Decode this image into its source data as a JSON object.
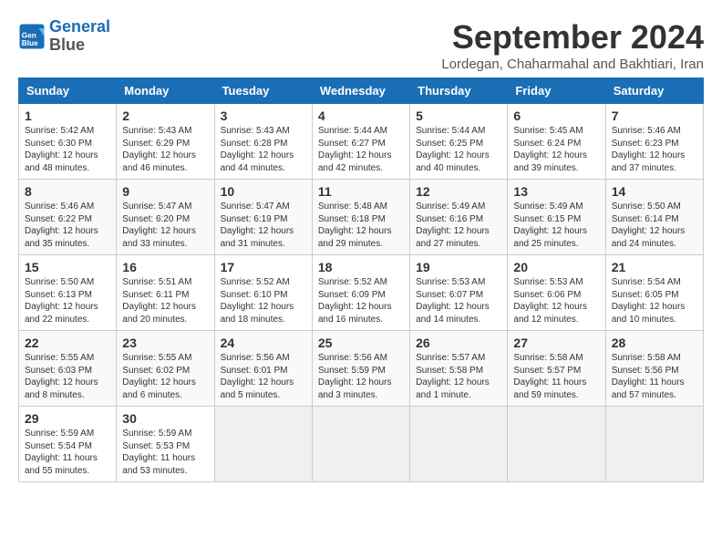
{
  "logo": {
    "line1": "General",
    "line2": "Blue"
  },
  "title": "September 2024",
  "subtitle": "Lordegan, Chaharmahal and Bakhtiari, Iran",
  "headers": [
    "Sunday",
    "Monday",
    "Tuesday",
    "Wednesday",
    "Thursday",
    "Friday",
    "Saturday"
  ],
  "weeks": [
    [
      {
        "day": "1",
        "sunrise": "Sunrise: 5:42 AM",
        "sunset": "Sunset: 6:30 PM",
        "daylight": "Daylight: 12 hours and 48 minutes."
      },
      {
        "day": "2",
        "sunrise": "Sunrise: 5:43 AM",
        "sunset": "Sunset: 6:29 PM",
        "daylight": "Daylight: 12 hours and 46 minutes."
      },
      {
        "day": "3",
        "sunrise": "Sunrise: 5:43 AM",
        "sunset": "Sunset: 6:28 PM",
        "daylight": "Daylight: 12 hours and 44 minutes."
      },
      {
        "day": "4",
        "sunrise": "Sunrise: 5:44 AM",
        "sunset": "Sunset: 6:27 PM",
        "daylight": "Daylight: 12 hours and 42 minutes."
      },
      {
        "day": "5",
        "sunrise": "Sunrise: 5:44 AM",
        "sunset": "Sunset: 6:25 PM",
        "daylight": "Daylight: 12 hours and 40 minutes."
      },
      {
        "day": "6",
        "sunrise": "Sunrise: 5:45 AM",
        "sunset": "Sunset: 6:24 PM",
        "daylight": "Daylight: 12 hours and 39 minutes."
      },
      {
        "day": "7",
        "sunrise": "Sunrise: 5:46 AM",
        "sunset": "Sunset: 6:23 PM",
        "daylight": "Daylight: 12 hours and 37 minutes."
      }
    ],
    [
      {
        "day": "8",
        "sunrise": "Sunrise: 5:46 AM",
        "sunset": "Sunset: 6:22 PM",
        "daylight": "Daylight: 12 hours and 35 minutes."
      },
      {
        "day": "9",
        "sunrise": "Sunrise: 5:47 AM",
        "sunset": "Sunset: 6:20 PM",
        "daylight": "Daylight: 12 hours and 33 minutes."
      },
      {
        "day": "10",
        "sunrise": "Sunrise: 5:47 AM",
        "sunset": "Sunset: 6:19 PM",
        "daylight": "Daylight: 12 hours and 31 minutes."
      },
      {
        "day": "11",
        "sunrise": "Sunrise: 5:48 AM",
        "sunset": "Sunset: 6:18 PM",
        "daylight": "Daylight: 12 hours and 29 minutes."
      },
      {
        "day": "12",
        "sunrise": "Sunrise: 5:49 AM",
        "sunset": "Sunset: 6:16 PM",
        "daylight": "Daylight: 12 hours and 27 minutes."
      },
      {
        "day": "13",
        "sunrise": "Sunrise: 5:49 AM",
        "sunset": "Sunset: 6:15 PM",
        "daylight": "Daylight: 12 hours and 25 minutes."
      },
      {
        "day": "14",
        "sunrise": "Sunrise: 5:50 AM",
        "sunset": "Sunset: 6:14 PM",
        "daylight": "Daylight: 12 hours and 24 minutes."
      }
    ],
    [
      {
        "day": "15",
        "sunrise": "Sunrise: 5:50 AM",
        "sunset": "Sunset: 6:13 PM",
        "daylight": "Daylight: 12 hours and 22 minutes."
      },
      {
        "day": "16",
        "sunrise": "Sunrise: 5:51 AM",
        "sunset": "Sunset: 6:11 PM",
        "daylight": "Daylight: 12 hours and 20 minutes."
      },
      {
        "day": "17",
        "sunrise": "Sunrise: 5:52 AM",
        "sunset": "Sunset: 6:10 PM",
        "daylight": "Daylight: 12 hours and 18 minutes."
      },
      {
        "day": "18",
        "sunrise": "Sunrise: 5:52 AM",
        "sunset": "Sunset: 6:09 PM",
        "daylight": "Daylight: 12 hours and 16 minutes."
      },
      {
        "day": "19",
        "sunrise": "Sunrise: 5:53 AM",
        "sunset": "Sunset: 6:07 PM",
        "daylight": "Daylight: 12 hours and 14 minutes."
      },
      {
        "day": "20",
        "sunrise": "Sunrise: 5:53 AM",
        "sunset": "Sunset: 6:06 PM",
        "daylight": "Daylight: 12 hours and 12 minutes."
      },
      {
        "day": "21",
        "sunrise": "Sunrise: 5:54 AM",
        "sunset": "Sunset: 6:05 PM",
        "daylight": "Daylight: 12 hours and 10 minutes."
      }
    ],
    [
      {
        "day": "22",
        "sunrise": "Sunrise: 5:55 AM",
        "sunset": "Sunset: 6:03 PM",
        "daylight": "Daylight: 12 hours and 8 minutes."
      },
      {
        "day": "23",
        "sunrise": "Sunrise: 5:55 AM",
        "sunset": "Sunset: 6:02 PM",
        "daylight": "Daylight: 12 hours and 6 minutes."
      },
      {
        "day": "24",
        "sunrise": "Sunrise: 5:56 AM",
        "sunset": "Sunset: 6:01 PM",
        "daylight": "Daylight: 12 hours and 5 minutes."
      },
      {
        "day": "25",
        "sunrise": "Sunrise: 5:56 AM",
        "sunset": "Sunset: 5:59 PM",
        "daylight": "Daylight: 12 hours and 3 minutes."
      },
      {
        "day": "26",
        "sunrise": "Sunrise: 5:57 AM",
        "sunset": "Sunset: 5:58 PM",
        "daylight": "Daylight: 12 hours and 1 minute."
      },
      {
        "day": "27",
        "sunrise": "Sunrise: 5:58 AM",
        "sunset": "Sunset: 5:57 PM",
        "daylight": "Daylight: 11 hours and 59 minutes."
      },
      {
        "day": "28",
        "sunrise": "Sunrise: 5:58 AM",
        "sunset": "Sunset: 5:56 PM",
        "daylight": "Daylight: 11 hours and 57 minutes."
      }
    ],
    [
      {
        "day": "29",
        "sunrise": "Sunrise: 5:59 AM",
        "sunset": "Sunset: 5:54 PM",
        "daylight": "Daylight: 11 hours and 55 minutes."
      },
      {
        "day": "30",
        "sunrise": "Sunrise: 5:59 AM",
        "sunset": "Sunset: 5:53 PM",
        "daylight": "Daylight: 11 hours and 53 minutes."
      },
      null,
      null,
      null,
      null,
      null
    ]
  ]
}
